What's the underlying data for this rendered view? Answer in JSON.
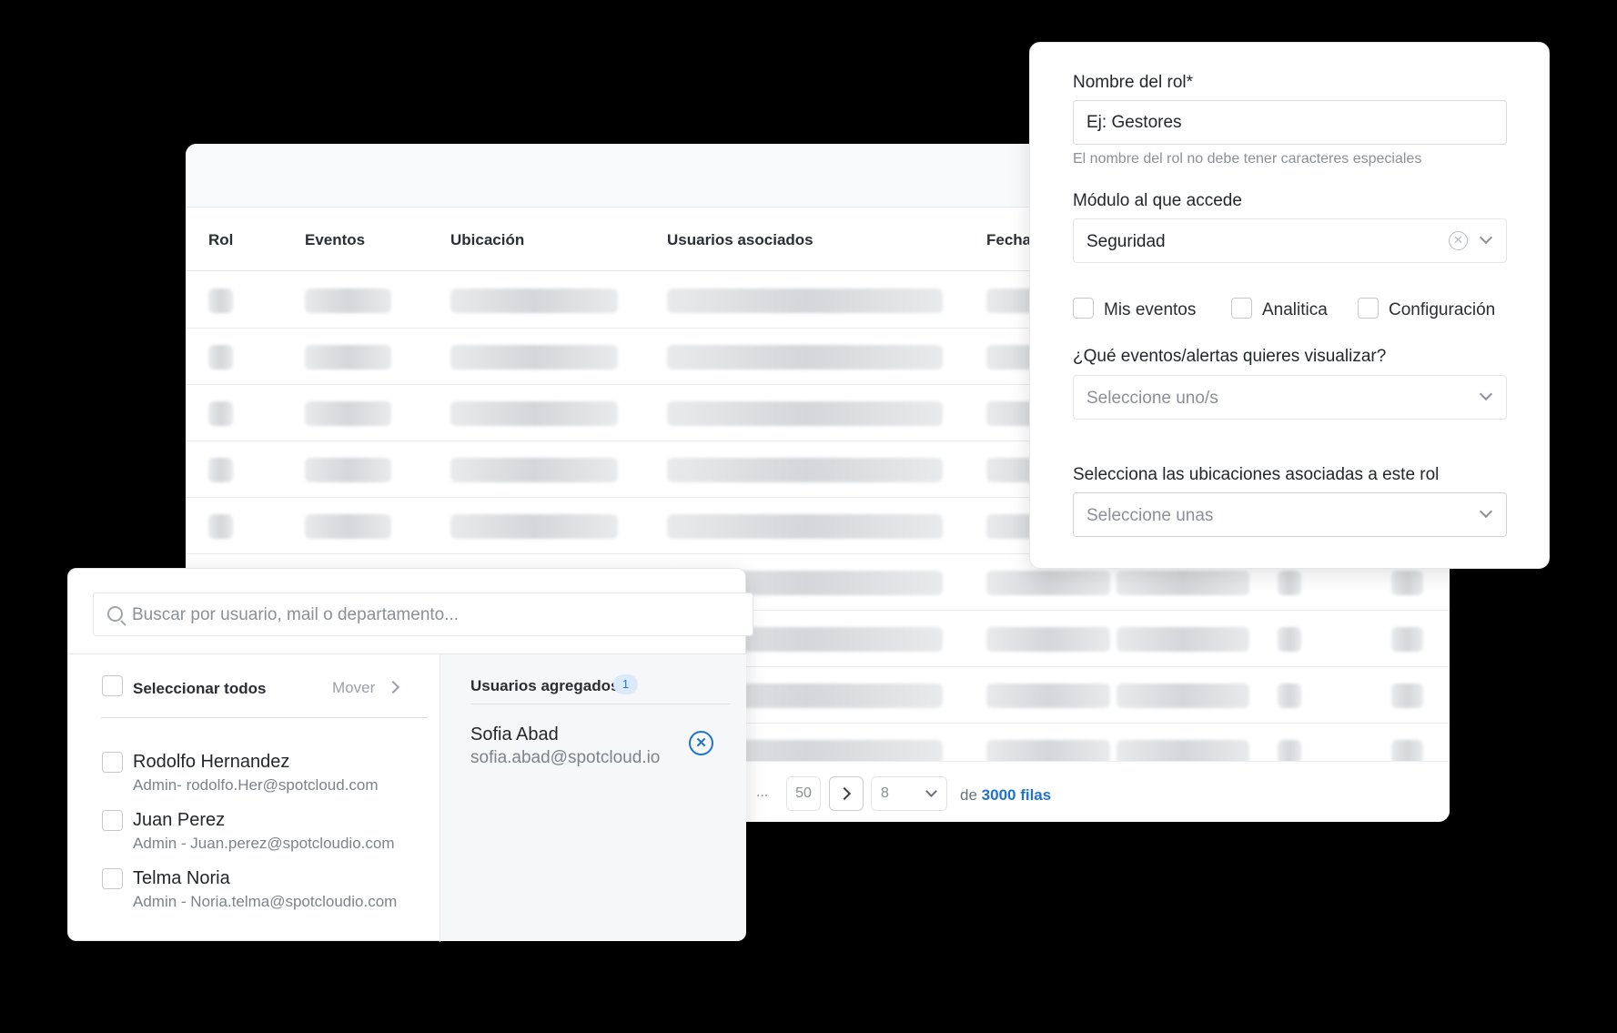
{
  "table": {
    "columns": [
      "Rol",
      "Eventos",
      "Ubicación",
      "Usuarios asociados",
      "Fecha"
    ],
    "pagination": {
      "ellipsis": "...",
      "last_page": "50",
      "page_size": "8",
      "total_prefix": "de",
      "total_value": "3000 filas"
    }
  },
  "role_form": {
    "name_label": "Nombre del rol*",
    "name_placeholder": "Ej: Gestores",
    "name_help": "El nombre del rol no debe tener caracteres especiales",
    "module_label": "Módulo al que accede",
    "module_value": "Seguridad",
    "modules": [
      "Mis eventos",
      "Analitica",
      "Configuración"
    ],
    "events_label": "¿Qué eventos/alertas quieres visualizar?",
    "events_placeholder": "Seleccione uno/s",
    "locations_label": "Selecciona las ubicaciones asociadas a este rol",
    "locations_placeholder": "Seleccione unas"
  },
  "user_picker": {
    "search_placeholder": "Buscar por usuario, mail o departamento...",
    "select_all_label": "Seleccionar todos",
    "move_label": "Mover",
    "users": [
      {
        "name": "Rodolfo Hernandez",
        "detail": "Admin- rodolfo.Her@spotcloud.com"
      },
      {
        "name": "Juan Perez",
        "detail": "Admin - Juan.perez@spotcloudio.com"
      },
      {
        "name": "Telma Noria",
        "detail": "Admin - Noria.telma@spotcloudio.com"
      }
    ],
    "added_title": "Usuarios agregados",
    "added_count": "1",
    "added_users": [
      {
        "name": "Sofia Abad",
        "email": "sofia.abad@spotcloud.io"
      }
    ]
  },
  "colors": {
    "accent": "#1f74c9",
    "badge_bg": "#dbeaf8",
    "page_bg": "#000000"
  }
}
